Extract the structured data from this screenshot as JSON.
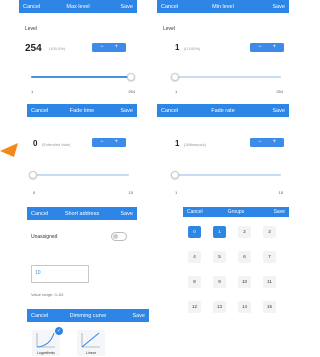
{
  "colors": {
    "header": "#2d86e5",
    "accent": "#3d8be8",
    "arrow": "#f28a1b"
  },
  "max_level": {
    "cancel": "Cancel",
    "title": "Max level",
    "save": "Save",
    "field_label": "Level",
    "value": "254",
    "unit": "(100.0%)",
    "stepper_minus": "−",
    "stepper_plus": "+",
    "slider_min": "1",
    "slider_max": "254",
    "slider_fraction": 1.0
  },
  "min_level": {
    "cancel": "Cancel",
    "title": "Min level",
    "save": "Save",
    "field_label": "Level",
    "value": "1",
    "unit": "(0.100%)",
    "stepper_minus": "−",
    "stepper_plus": "+",
    "slider_min": "1",
    "slider_max": "254",
    "slider_fraction": 0.0
  },
  "fade_time": {
    "cancel": "Cancel",
    "title": "Fade time",
    "save": "Save",
    "value": "0",
    "unit": "(Extended fade)",
    "stepper_minus": "−",
    "stepper_plus": "+",
    "slider_min": "0",
    "slider_max": "15",
    "slider_fraction": 0.0
  },
  "fade_rate": {
    "cancel": "Cancel",
    "title": "Fade rate",
    "save": "Save",
    "value": "1",
    "unit": "(358steps/s)",
    "stepper_minus": "−",
    "stepper_plus": "+",
    "slider_min": "1",
    "slider_max": "15",
    "slider_fraction": 0.0
  },
  "short_address": {
    "cancel": "Cancel",
    "title": "Short address",
    "save": "Save",
    "unassigned_label": "Unassigned",
    "unassigned_on": false,
    "address_value": "10",
    "range_hint": "Value range: 0–63"
  },
  "groups": {
    "cancel": "Cancel",
    "title": "Groups",
    "save": "Save",
    "items": [
      {
        "label": "0",
        "on": true
      },
      {
        "label": "1",
        "on": true
      },
      {
        "label": "2",
        "on": false
      },
      {
        "label": "3",
        "on": false
      },
      {
        "label": "4",
        "on": false
      },
      {
        "label": "5",
        "on": false
      },
      {
        "label": "6",
        "on": false
      },
      {
        "label": "7",
        "on": false
      },
      {
        "label": "8",
        "on": false
      },
      {
        "label": "9",
        "on": false
      },
      {
        "label": "10",
        "on": false
      },
      {
        "label": "11",
        "on": false
      },
      {
        "label": "12",
        "on": false
      },
      {
        "label": "13",
        "on": false
      },
      {
        "label": "14",
        "on": false
      },
      {
        "label": "15",
        "on": false
      }
    ]
  },
  "dimming_curve": {
    "cancel": "Cancel",
    "title": "Dimming curve",
    "save": "Save",
    "options": [
      {
        "label": "Logarithmic",
        "selected": true,
        "check": "✓"
      },
      {
        "label": "Linear",
        "selected": false
      }
    ]
  }
}
